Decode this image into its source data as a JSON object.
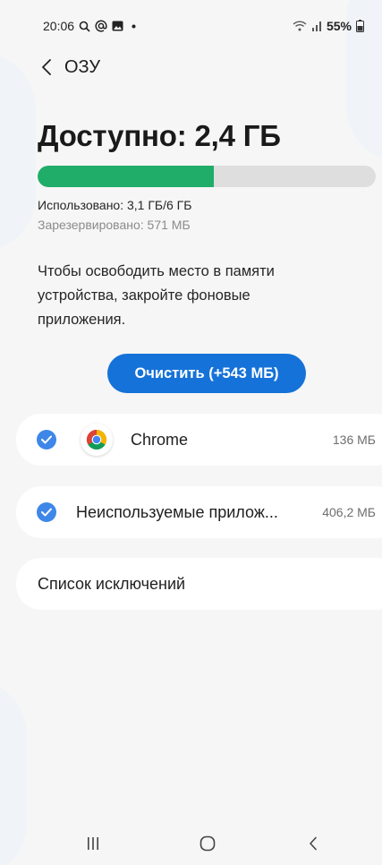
{
  "status_bar": {
    "time": "20:06",
    "battery": "55%",
    "icons": [
      "search-icon",
      "at-sign-icon",
      "gallery-icon",
      "dot-icon",
      "wifi-icon",
      "signal-icon",
      "battery-icon"
    ]
  },
  "header": {
    "title": "ОЗУ",
    "back_icon": "chevron-left-icon"
  },
  "memory": {
    "available": "Доступно: 2,4 ГБ",
    "used_fraction": 0.52,
    "used_label": "Использовано: 3,1 ГБ/6 ГБ",
    "reserved_label": "Зарезервировано: 571 МБ",
    "bar_color": "#20ad6a",
    "track_color": "#dedede"
  },
  "hint": "Чтобы освободить место в памяти устройства, закройте фоновые приложения.",
  "clean_button": {
    "label": "Очистить (+543 МБ)",
    "color": "#1572d8"
  },
  "apps": [
    {
      "name": "Chrome",
      "size": "136 МБ",
      "checked": true,
      "icon": "chrome-icon"
    },
    {
      "name": "Неиспользуемые прилож...",
      "size": "406,2 МБ",
      "checked": true
    }
  ],
  "exclusions_label": "Список исключений",
  "nav": {
    "icons": [
      "recents-icon",
      "home-icon",
      "back-icon"
    ]
  }
}
